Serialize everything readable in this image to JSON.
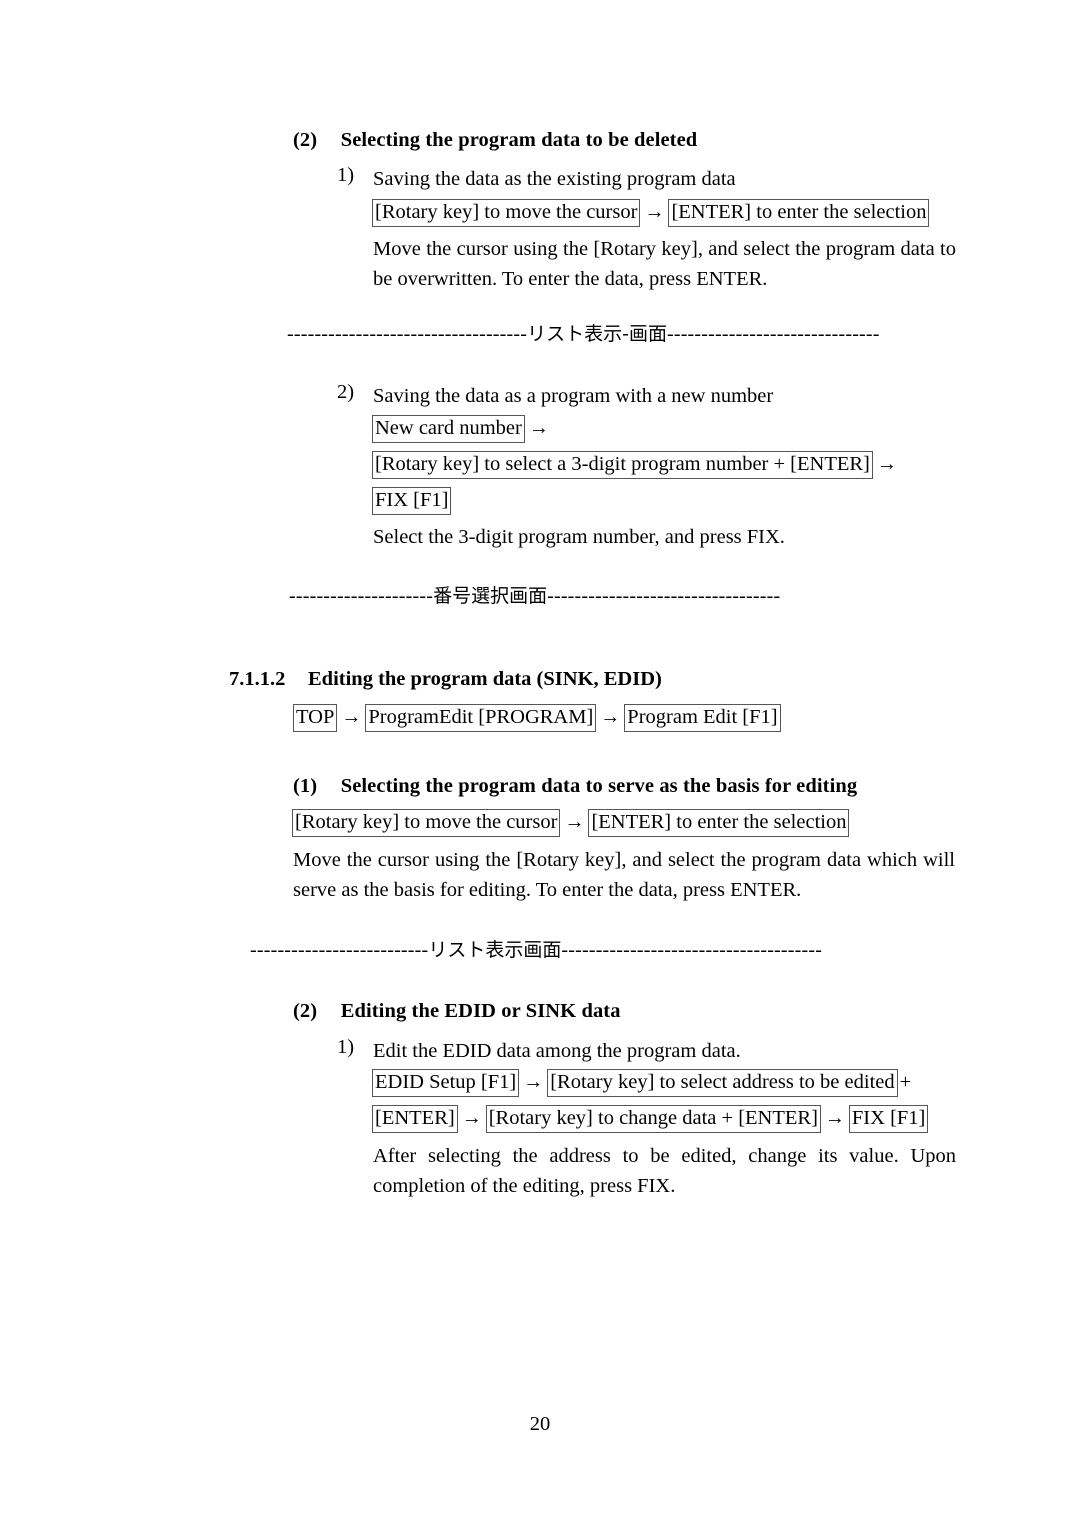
{
  "document": {
    "page_number": "20"
  },
  "section_deleted": {
    "marker": "(2)",
    "heading": "Selecting the program data to be deleted",
    "item1": {
      "marker": "1)",
      "title": "Saving the data as the existing program data",
      "keys": {
        "box1": "[Rotary key] to move the cursor",
        "arrow1": "→",
        "box2": "[ENTER] to enter the selection"
      },
      "description": "Move the cursor using the [Rotary key], and select the program data to be overwritten.    To enter the data, press ENTER."
    },
    "separator1": {
      "left_dashes": "-----------------------------------",
      "label": "リスト表示-画面",
      "right_dashes": "-------------------------------"
    },
    "item2": {
      "marker": "2)",
      "title": "Saving the data as a program with a new number",
      "keys": {
        "box1": "New card number",
        "arrow1": "→",
        "box2": "[Rotary key] to select a 3-digit program number + [ENTER]",
        "arrow2": "→",
        "box3": "FIX [F1]"
      },
      "description": "Select the 3-digit program number, and press FIX."
    },
    "separator2": {
      "left_dashes": "---------------------",
      "label": "番号選択画面",
      "right_dashes": "----------------------------------"
    }
  },
  "section_editing": {
    "number": "7.1.1.2",
    "heading": "Editing the program data (SINK, EDID)",
    "nav_path": {
      "box1": "TOP",
      "arrow1": "→",
      "box2": "ProgramEdit [PROGRAM]",
      "arrow2": "→",
      "box3": "Program Edit [F1]"
    },
    "part1": {
      "marker": "(1)",
      "heading": "Selecting the program data to serve as the basis for editing",
      "keys": {
        "box1": "[Rotary key] to move the cursor",
        "arrow1": "→",
        "box2": "[ENTER] to enter the selection"
      },
      "description": "Move the cursor using the [Rotary key], and select the program data which will serve as the basis for editing.    To enter the data, press ENTER."
    },
    "separator3": {
      "left_dashes": "--------------------------",
      "label": "リスト表示画面",
      "right_dashes": "--------------------------------------"
    },
    "part2": {
      "marker": "(2)",
      "heading": "Editing the EDID or SINK data",
      "item1": {
        "marker": "1)",
        "title": "Edit the EDID data among the program data.",
        "keys_line1": {
          "box1": "EDID Setup [F1]",
          "arrow1": "→",
          "box2": "[Rotary key] to select address to be edited",
          "plus": "+"
        },
        "keys_line2": {
          "box1": "[ENTER]",
          "arrow1": "→",
          "box2": "[Rotary key] to change data + [ENTER]",
          "arrow2": "→",
          "box3": "FIX [F1]"
        },
        "description": "After selecting the address to be edited, change its value.    Upon completion of the editing, press FIX."
      }
    }
  }
}
